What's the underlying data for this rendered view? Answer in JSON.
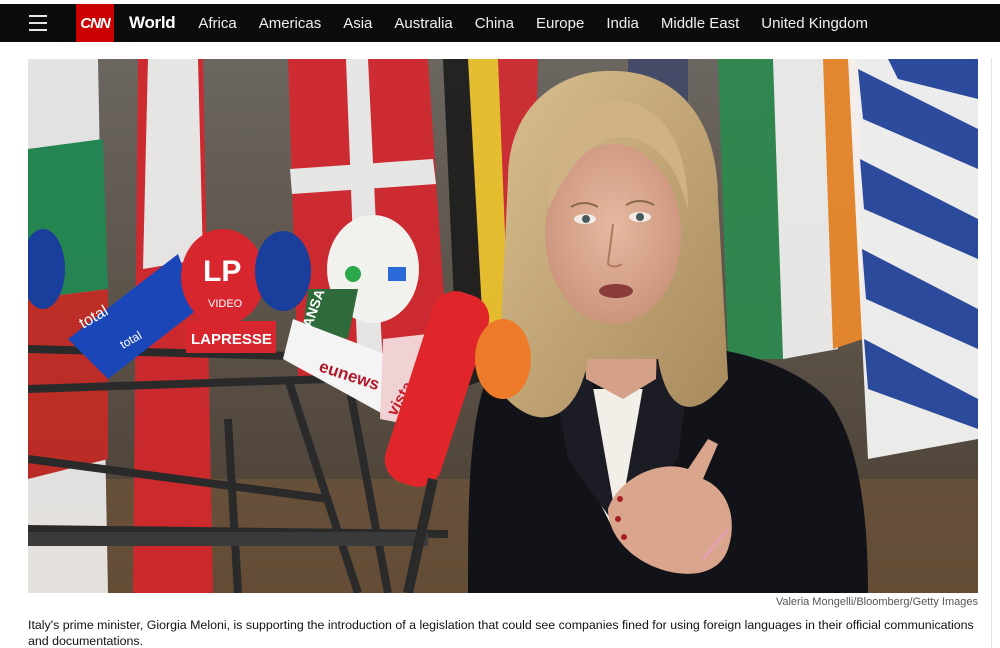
{
  "nav": {
    "logo_text": "CNN",
    "section_title": "World",
    "links": [
      "Africa",
      "Americas",
      "Asia",
      "Australia",
      "China",
      "Europe",
      "India",
      "Middle East",
      "United Kingdom"
    ]
  },
  "photo": {
    "mic_labels": {
      "lp": "LP",
      "lp_sub": "VIDEO",
      "total": "total",
      "total_small": "total",
      "lapresse": "LAPRESSE",
      "euronews": "eunews",
      "ansa": "ANSA",
      "vista": "vista"
    },
    "credit": "Valeria Mongelli/Bloomberg/Getty Images"
  },
  "caption": "Italy's prime minister, Giorgia Meloni, is supporting the introduction of a legislation that could see companies fined for using foreign languages in their official communications and documentations.",
  "colors": {
    "nav_bg": "#0c0c0c",
    "brand_red": "#cc0000"
  }
}
